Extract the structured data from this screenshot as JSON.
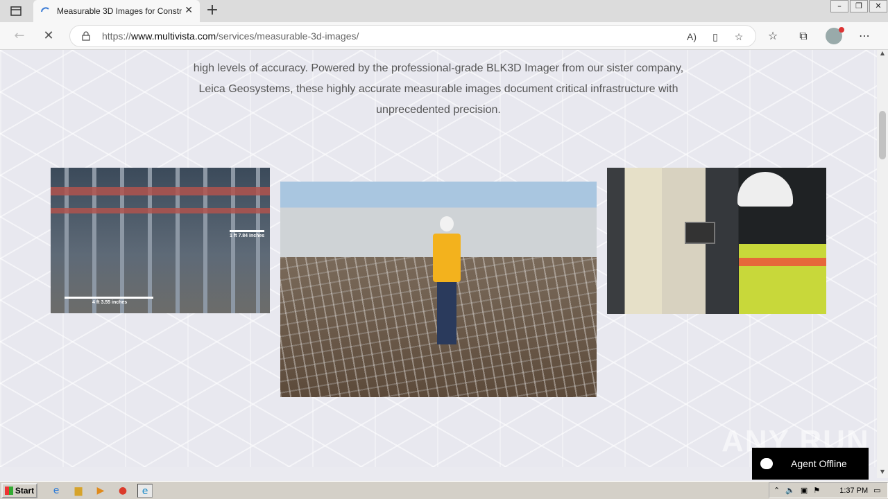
{
  "browser": {
    "tab_title": "Measurable 3D Images for Constr",
    "url_prefix": "https://",
    "url_host": "www.multivista.com",
    "url_path": "/services/measurable-3d-images/"
  },
  "page": {
    "paragraph_line1": "high levels of accuracy. Powered by the professional-grade BLK3D Imager from our sister company,",
    "paragraph_line2": "Leica Geosystems, these highly accurate measurable images document critical infrastructure with",
    "paragraph_line3": "unprecedented precision.",
    "measure1": "1 ft 7.84 inches",
    "measure2": "4 ft 3.55 inches"
  },
  "chat": {
    "label": "Agent Offline"
  },
  "watermark": "ANY RUN",
  "taskbar": {
    "start_label": "Start",
    "clock": "1:37 PM"
  },
  "colors": {
    "chat_bg": "#000000",
    "page_bg": "#e8e8ef",
    "text": "#555555"
  }
}
